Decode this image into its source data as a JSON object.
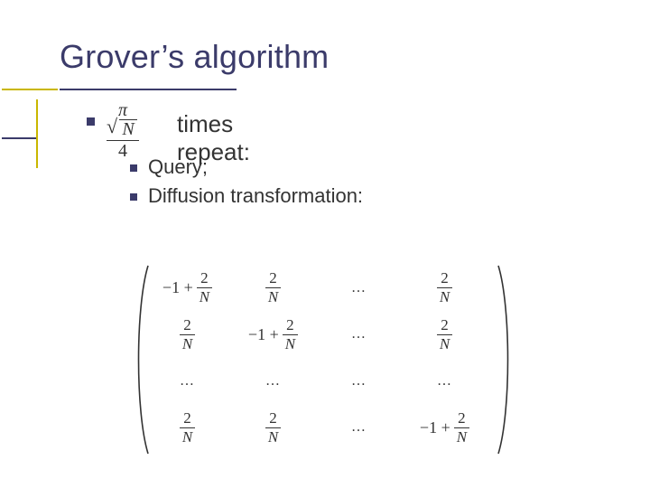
{
  "title": "Grover’s algorithm",
  "line1": {
    "fraction": {
      "num_symbol": "π",
      "den": "4",
      "radicand": "N"
    },
    "after_text": "times repeat:"
  },
  "sub_items": [
    "Query;",
    "Diffusion transformation:"
  ],
  "matrix": {
    "diag_prefix": "−1 +",
    "frac": {
      "num": "2",
      "den": "N"
    },
    "ellipsis": "…"
  }
}
